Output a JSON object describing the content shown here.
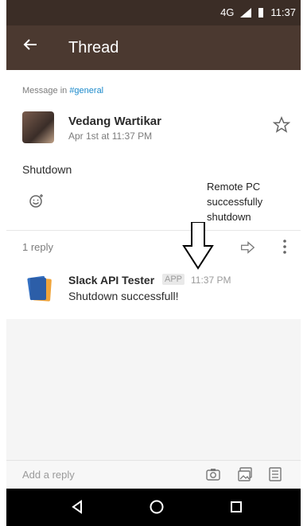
{
  "status_bar": {
    "network": "4G",
    "time": "11:37"
  },
  "appbar": {
    "title": "Thread"
  },
  "thread": {
    "message_in_prefix": "Message in ",
    "channel": "#general",
    "author": "Vedang Wartikar",
    "date": "Apr 1st at 11:37 PM",
    "text": "Shutdown",
    "annotation": "Remote PC successfully shutdown",
    "reply_count": "1 reply"
  },
  "reply": {
    "author": "Slack API Tester",
    "badge": "APP",
    "time": "11:37 PM",
    "text": "Shutdown successfull!"
  },
  "composer": {
    "placeholder": "Add a reply"
  }
}
